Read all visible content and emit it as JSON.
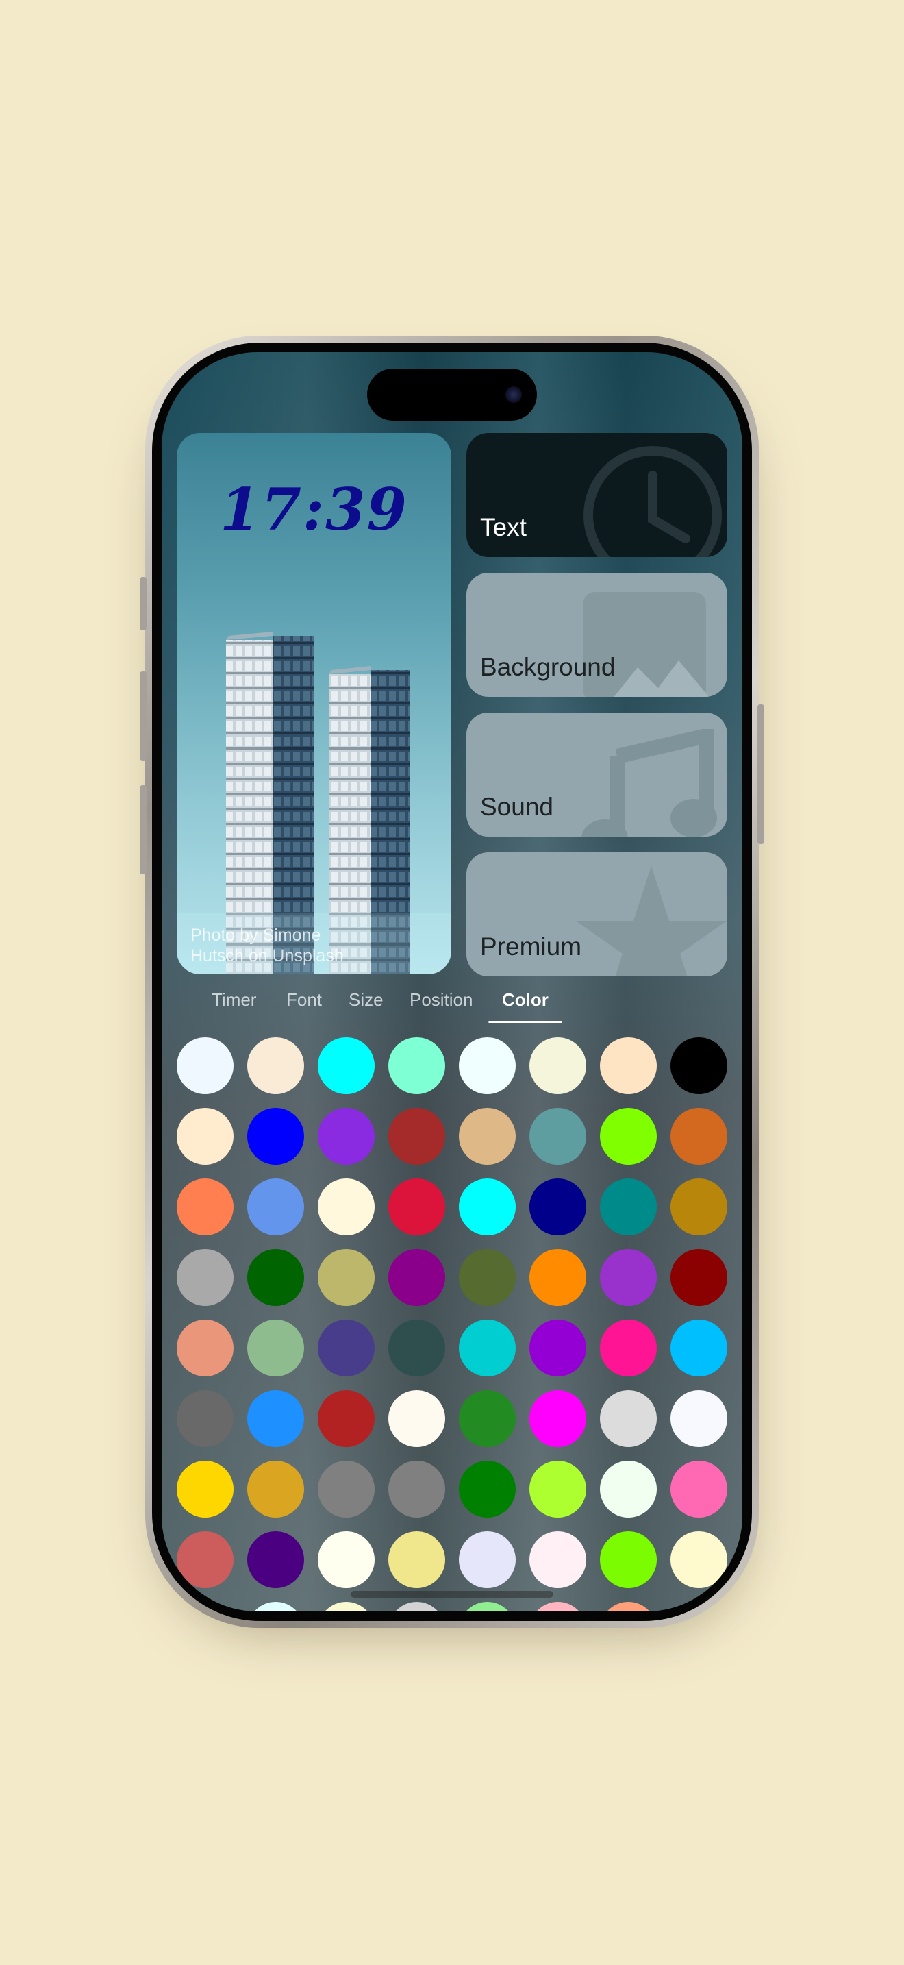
{
  "preview": {
    "time": "17:39",
    "photo_credit": "Photo by Simone Hutsch on Unsplash"
  },
  "menu": {
    "text_label": "Text",
    "background_label": "Background",
    "sound_label": "Sound",
    "premium_label": "Premium"
  },
  "tabs": [
    {
      "label": "Timer",
      "active": false
    },
    {
      "label": "Font",
      "active": false
    },
    {
      "label": "Size",
      "active": false
    },
    {
      "label": "Position",
      "active": false
    },
    {
      "label": "Color",
      "active": true
    }
  ],
  "colors": [
    "#f0f8ff",
    "#faebd7",
    "#00ffff",
    "#7fffd4",
    "#f0ffff",
    "#f5f5dc",
    "#ffe4c4",
    "#000000",
    "#ffebcd",
    "#0000ff",
    "#8a2be2",
    "#a52a2a",
    "#deb887",
    "#5f9ea0",
    "#7fff00",
    "#d2691e",
    "#ff7f50",
    "#6495ed",
    "#fff8dc",
    "#dc143c",
    "#00ffff",
    "#00008b",
    "#008b8b",
    "#b8860b",
    "#a9a9a9",
    "#006400",
    "#bdb76b",
    "#8b008b",
    "#556b2f",
    "#ff8c00",
    "#9932cc",
    "#8b0000",
    "#e9967a",
    "#8fbc8f",
    "#483d8b",
    "#2f4f4f",
    "#00ced1",
    "#9400d3",
    "#ff1493",
    "#00bfff",
    "#696969",
    "#1e90ff",
    "#b22222",
    "#fffaf0",
    "#228b22",
    "#ff00ff",
    "#dcdcdc",
    "#f8f8ff",
    "#ffd700",
    "#daa520",
    "#808080",
    "#808080",
    "#008000",
    "#adff2f",
    "#f0fff0",
    "#ff69b4",
    "#cd5c5c",
    "#4b0082",
    "#fffff0",
    "#f0e68c",
    "#e6e6fa",
    "#fff0f5",
    "#7cfc00",
    "#fffacd",
    "#f08080",
    "#e0ffff",
    "#fafad2",
    "#d3d3d3",
    "#90ee90",
    "#ffb6c1",
    "#ffa07a",
    "#20b2aa"
  ]
}
